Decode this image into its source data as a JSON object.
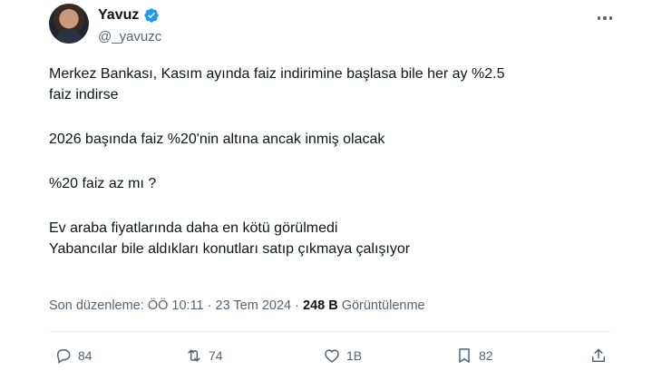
{
  "author": {
    "name": "Yavuz",
    "handle": "@_yavuzc"
  },
  "tweet": {
    "lines": [
      "Merkez Bankası, Kasım ayında faiz indirimine başlasa bile her ay %2.5",
      "faiz indirse",
      "2026 başında faiz %20'nin altına ancak inmiş olacak",
      "%20 faiz az mı ?",
      "Ev araba fiyatlarında daha en kötü görülmedi",
      "Yabancılar bile aldıkları konutları satıp çıkmaya çalışıyor"
    ]
  },
  "meta": {
    "edited": "Son düzenleme: ÖÖ 10:11 · 23 Tem 2024 · ",
    "views_count": "248 B",
    "views_label": " Görüntülenme"
  },
  "actions": {
    "replies": "84",
    "reposts": "74",
    "likes": "1B",
    "bookmarks": "82"
  },
  "colors": {
    "verified": "#1d9bf0",
    "secondary_text": "#536471",
    "primary_text": "#0f1419"
  },
  "icons": [
    "verified-badge-icon",
    "more-options-icon",
    "reply-icon",
    "repost-icon",
    "like-icon",
    "bookmark-icon",
    "share-icon"
  ]
}
